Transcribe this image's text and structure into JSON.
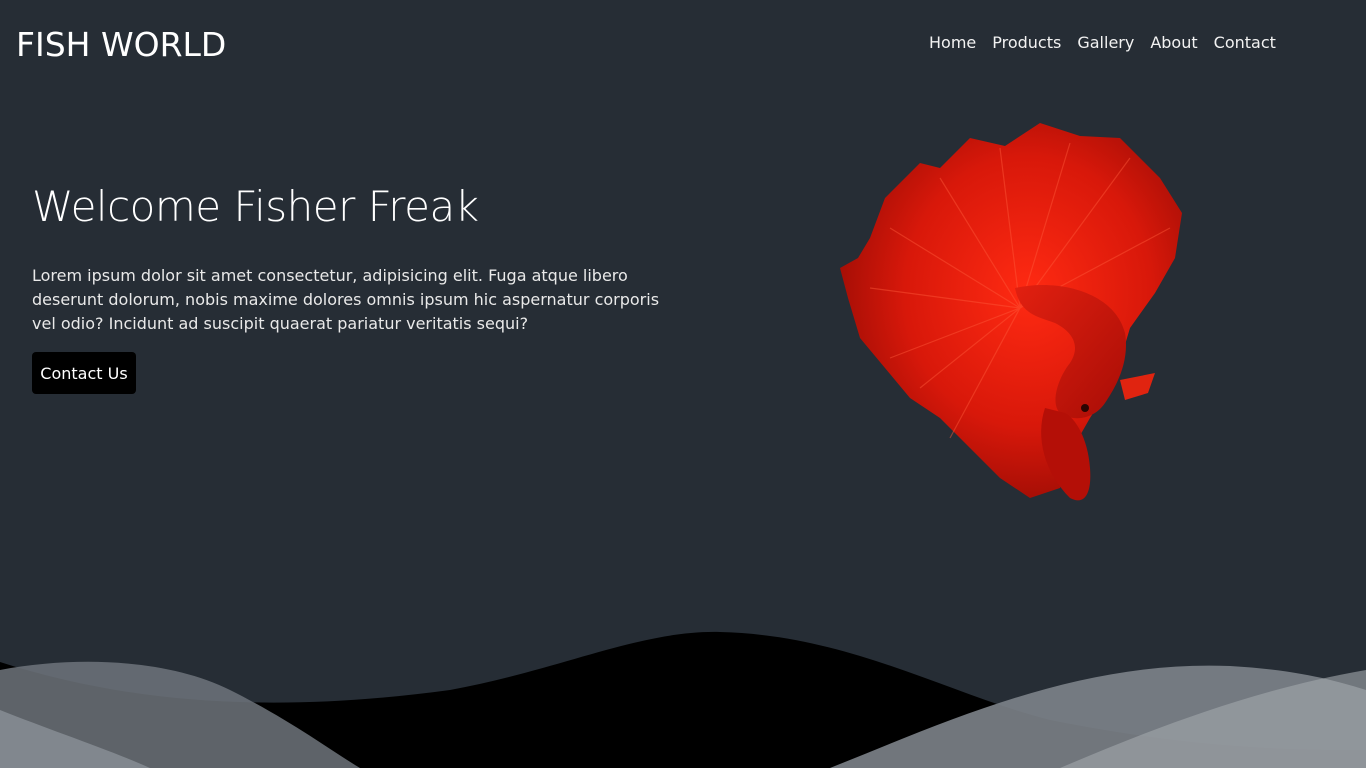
{
  "header": {
    "logo": "FISH WORLD",
    "nav": [
      "Home",
      "Products",
      "Gallery",
      "About",
      "Contact"
    ]
  },
  "hero": {
    "title": "Welcome Fisher Freak",
    "text": "Lorem ipsum dolor sit amet consectetur, adipisicing elit. Fuga atque libero deserunt dolorum, nobis maxime dolores omnis ipsum hic aspernatur corporis vel odio? Incidunt ad suscipit quaerat pariatur veritatis sequi?",
    "button_label": "Contact Us"
  },
  "colors": {
    "background": "#262d35",
    "button": "#000000",
    "fish": "#d41a0c"
  },
  "icons": {
    "hero_image": "red-betta-fish"
  }
}
